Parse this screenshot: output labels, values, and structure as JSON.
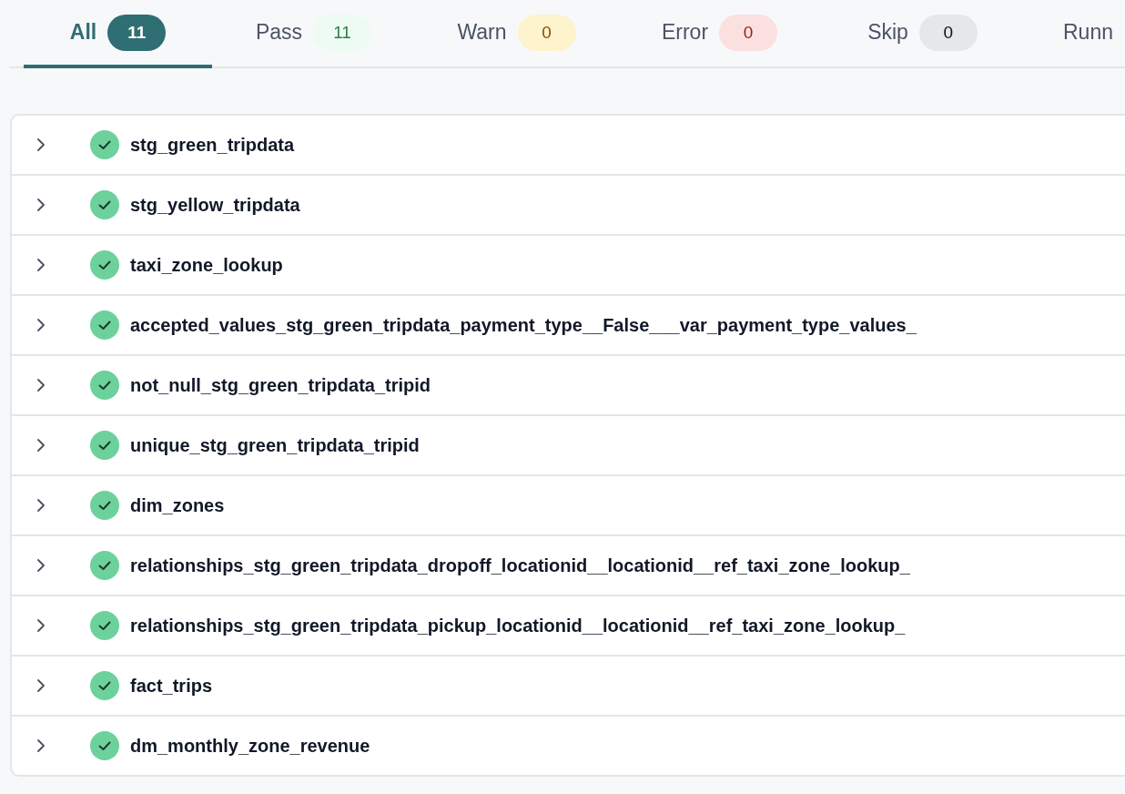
{
  "tabs": [
    {
      "label": "All",
      "count": "11",
      "kind": "all",
      "selected": true
    },
    {
      "label": "Pass",
      "count": "11",
      "kind": "pass",
      "selected": false
    },
    {
      "label": "Warn",
      "count": "0",
      "kind": "warn",
      "selected": false
    },
    {
      "label": "Error",
      "count": "0",
      "kind": "error",
      "selected": false
    },
    {
      "label": "Skip",
      "count": "0",
      "kind": "skip",
      "selected": false
    },
    {
      "label": "Runn",
      "selected": false
    }
  ],
  "results": [
    {
      "name": "stg_green_tripdata",
      "kind": "pass",
      "expanded": false
    },
    {
      "name": "stg_yellow_tripdata",
      "kind": "pass",
      "expanded": false
    },
    {
      "name": "taxi_zone_lookup",
      "kind": "pass",
      "expanded": false
    },
    {
      "name": "accepted_values_stg_green_tripdata_payment_type__False___var_payment_type_values_",
      "kind": "pass",
      "expanded": false
    },
    {
      "name": "not_null_stg_green_tripdata_tripid",
      "kind": "pass",
      "expanded": false
    },
    {
      "name": "unique_stg_green_tripdata_tripid",
      "kind": "pass",
      "expanded": false
    },
    {
      "name": "dim_zones",
      "kind": "pass",
      "expanded": false
    },
    {
      "name": "relationships_stg_green_tripdata_dropoff_locationid__locationid__ref_taxi_zone_lookup_",
      "kind": "pass",
      "expanded": false
    },
    {
      "name": "relationships_stg_green_tripdata_pickup_locationid__locationid__ref_taxi_zone_lookup_",
      "kind": "pass",
      "expanded": false
    },
    {
      "name": "fact_trips",
      "kind": "pass",
      "expanded": false
    },
    {
      "name": "dm_monthly_zone_revenue",
      "kind": "pass",
      "expanded": false
    }
  ]
}
